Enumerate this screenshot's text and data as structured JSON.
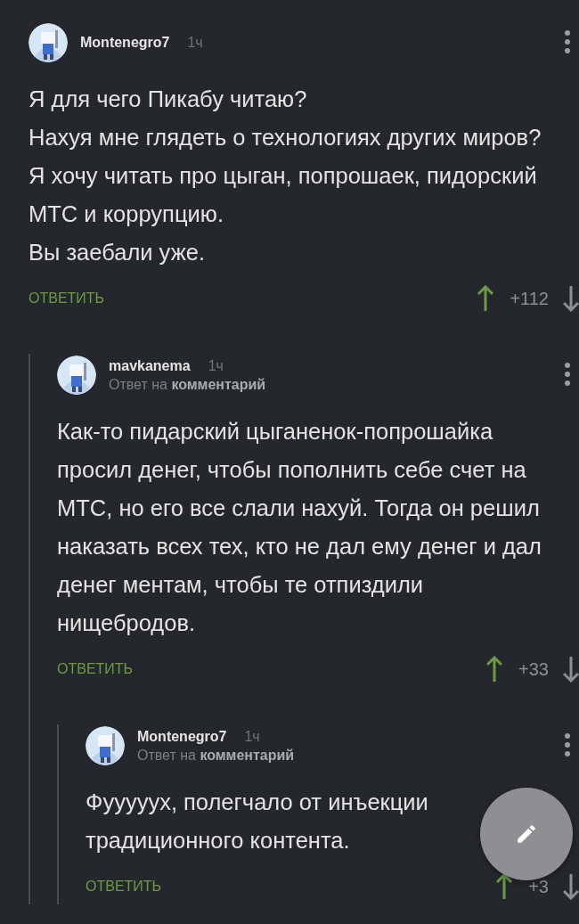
{
  "comments": [
    {
      "author": "Montenegro7",
      "time": "1ч",
      "paragraphs": [
        "Я для чего Пикабу читаю?",
        "Нахуя мне глядеть о технологиях других миров?",
        "Я хочу читать про цыган, попрошаек, пидорский МТС и коррупцию.",
        "Вы заебали уже."
      ],
      "reply_label": "ОТВЕТИТЬ",
      "score": "+112",
      "children": [
        {
          "author": "mavkanema",
          "time": "1ч",
          "reply_to": {
            "prefix": "Ответ на",
            "target": "комментарий"
          },
          "paragraphs": [
            "Как-то пидарский цыганенок-попрошайка просил денег, чтобы пополнить себе счет на МТС, но его все слали нахуй. Тогда он решил наказать всех тех, кто не дал ему денег и дал денег ментам, чтобы те отпиздили нищебродов."
          ],
          "reply_label": "ОТВЕТИТЬ",
          "score": "+33",
          "children": [
            {
              "author": "Montenegro7",
              "time": "1ч",
              "reply_to": {
                "prefix": "Ответ на",
                "target": "комментарий"
              },
              "paragraphs": [
                "Фууууух, полегчало от инъекции традиционного контента."
              ],
              "reply_label": "ОТВЕТИТЬ",
              "score": "+3"
            }
          ]
        }
      ]
    }
  ]
}
